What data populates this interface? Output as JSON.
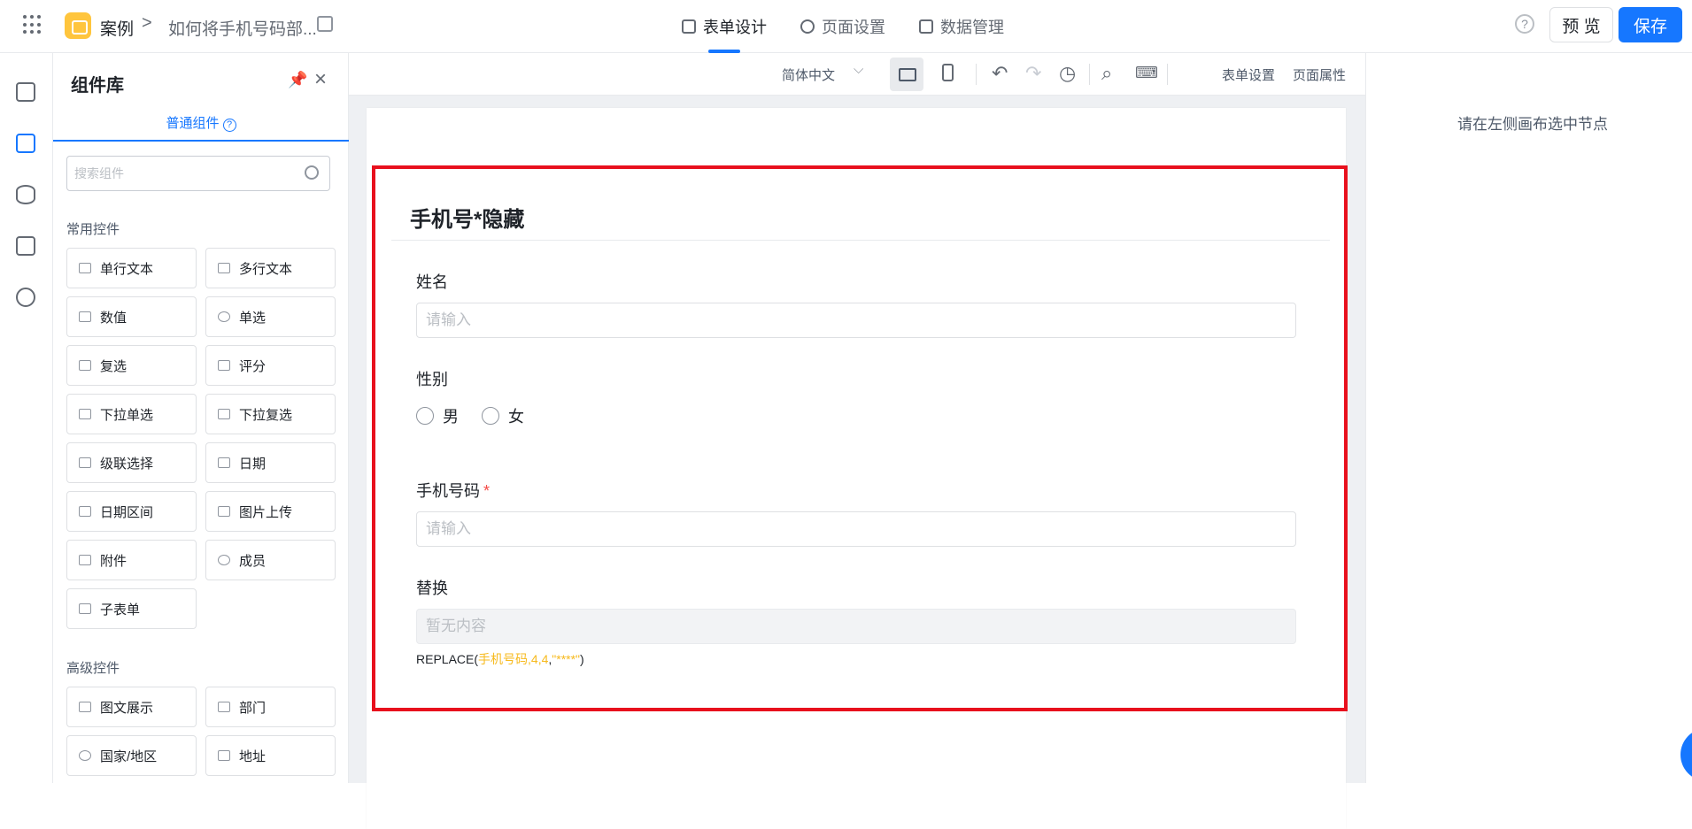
{
  "header": {
    "breadcrumb_app": "案例",
    "breadcrumb_sep": ">",
    "breadcrumb_page": "如何将手机号码部...",
    "tabs": [
      {
        "label": "表单设计",
        "icon": "document-icon",
        "active": true
      },
      {
        "label": "页面设置",
        "icon": "gear-icon",
        "active": false
      },
      {
        "label": "数据管理",
        "icon": "table-icon",
        "active": false
      }
    ],
    "help": "?",
    "preview_label": "预 览",
    "save_label": "保存",
    "accent_color": "#1677ff",
    "logo_color": "#ffc53d"
  },
  "rail": {
    "icons": [
      "outline-icon",
      "components-icon",
      "data-source-icon",
      "js-icon",
      "globe-icon"
    ]
  },
  "panel": {
    "title": "组件库",
    "subtab": "普通组件",
    "subtab_help": "?",
    "search_placeholder": "搜索组件",
    "common_section": "常用控件",
    "common_items": [
      {
        "label": "单行文本",
        "icon": "single-line-text-icon"
      },
      {
        "label": "多行文本",
        "icon": "multi-line-text-icon"
      },
      {
        "label": "数值",
        "icon": "number-icon"
      },
      {
        "label": "单选",
        "icon": "radio-icon"
      },
      {
        "label": "复选",
        "icon": "checkbox-icon"
      },
      {
        "label": "评分",
        "icon": "star-icon"
      },
      {
        "label": "下拉单选",
        "icon": "dropdown-icon"
      },
      {
        "label": "下拉复选",
        "icon": "multi-select-icon"
      },
      {
        "label": "级联选择",
        "icon": "cascade-icon"
      },
      {
        "label": "日期",
        "icon": "calendar-icon"
      },
      {
        "label": "日期区间",
        "icon": "date-range-icon"
      },
      {
        "label": "图片上传",
        "icon": "image-upload-icon"
      },
      {
        "label": "附件",
        "icon": "paperclip-icon"
      },
      {
        "label": "成员",
        "icon": "person-icon"
      },
      {
        "label": "子表单",
        "icon": "subform-icon"
      }
    ],
    "advanced_section": "高级控件",
    "advanced_items": [
      {
        "label": "图文展示",
        "icon": "rich-text-icon"
      },
      {
        "label": "部门",
        "icon": "department-icon"
      },
      {
        "label": "国家/地区",
        "icon": "globe-icon"
      },
      {
        "label": "地址",
        "icon": "map-icon"
      }
    ]
  },
  "toolbar": {
    "language": "简体中文",
    "form_settings": "表单设置",
    "page_props": "页面属性"
  },
  "form": {
    "title": "手机号*隐藏",
    "fields": {
      "name_label": "姓名",
      "name_placeholder": "请输入",
      "gender_label": "性别",
      "gender_options": [
        "男",
        "女"
      ],
      "phone_label": "手机号码",
      "phone_required": "*",
      "phone_placeholder": "请输入",
      "replace_label": "替换",
      "replace_placeholder": "暂无内容"
    },
    "formula": {
      "fn_open": "REPLACE(",
      "field": "手机号码",
      "comma1": ",",
      "arg1": "4",
      "comma2": ",",
      "arg2": "4",
      "comma3": ",",
      "arg3": "\"****\"",
      "close": ")"
    },
    "highlight_color": "#e8101d"
  },
  "props": {
    "empty_message": "请在左侧画布选中节点"
  }
}
